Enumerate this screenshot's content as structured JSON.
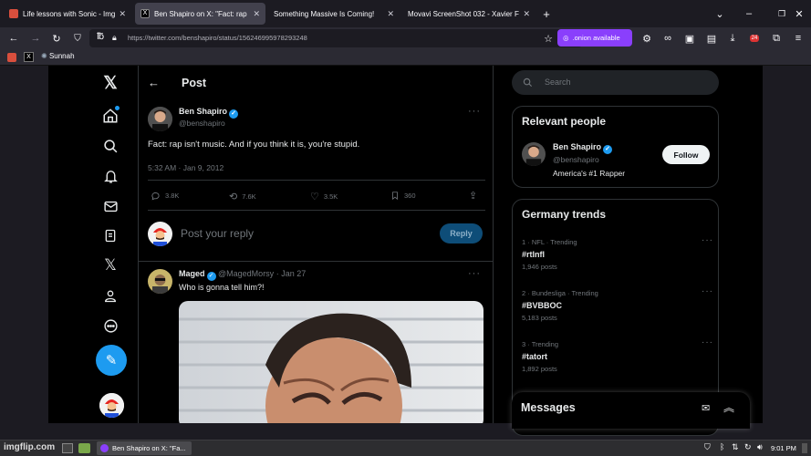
{
  "tabs": [
    {
      "title": "Life lessons with Sonic - Imgflip",
      "fav_color": "#d94f3d",
      "active": false
    },
    {
      "title": "Ben Shapiro on X: \"Fact: rap is",
      "fav_color": "#000000",
      "active": true
    },
    {
      "title": "Something Massive Is Coming!",
      "fav_color": "",
      "active": false
    },
    {
      "title": "Movavi ScreenShot 032 - Xavier F",
      "fav_color": "",
      "active": false
    }
  ],
  "browser": {
    "url": "https://twitter.com/benshapiro/status/156246995978293248",
    "onion_label": ".onion available",
    "bookmark_label": "Sunnah",
    "badge_count": "24"
  },
  "header": {
    "title": "Post"
  },
  "tweet": {
    "author_name": "Ben Shapiro",
    "handle": "@benshapiro",
    "text": "Fact: rap isn't music. And if you think it is, you're stupid.",
    "timestamp": "5:32 AM · Jan 9, 2012",
    "replies": "3.8K",
    "reposts": "7.6K",
    "likes": "3.5K",
    "bookmarks": "360"
  },
  "reply_box": {
    "placeholder": "Post your reply",
    "button": "Reply"
  },
  "reply": {
    "author_name": "Maged",
    "handle": "@MagedMorsy",
    "date": "Jan 27",
    "text": "Who is gonna tell him?!"
  },
  "search": {
    "placeholder": "Search"
  },
  "relevant": {
    "title": "Relevant people",
    "name": "Ben Shapiro",
    "handle": "@benshapiro",
    "bio": "America's #1 Rapper",
    "follow": "Follow"
  },
  "trends": {
    "title": "Germany trends",
    "items": [
      {
        "meta": "1 · NFL · Trending",
        "name": "#rtlnfl",
        "count": "1,946 posts"
      },
      {
        "meta": "2 · Bundesliga · Trending",
        "name": "#BVBBOC",
        "count": "5,183 posts"
      },
      {
        "meta": "3 · Trending",
        "name": "#tatort",
        "count": "1,892 posts"
      }
    ]
  },
  "messages": {
    "title": "Messages"
  },
  "taskbar": {
    "watermark": "imgflip.com",
    "window_title": "Ben Shapiro on X: \"Fa...",
    "clock": "9:01 PM"
  },
  "colors": {
    "accent": "#1d9bf0",
    "onion": "#8a3ffc",
    "background": "#000000"
  }
}
